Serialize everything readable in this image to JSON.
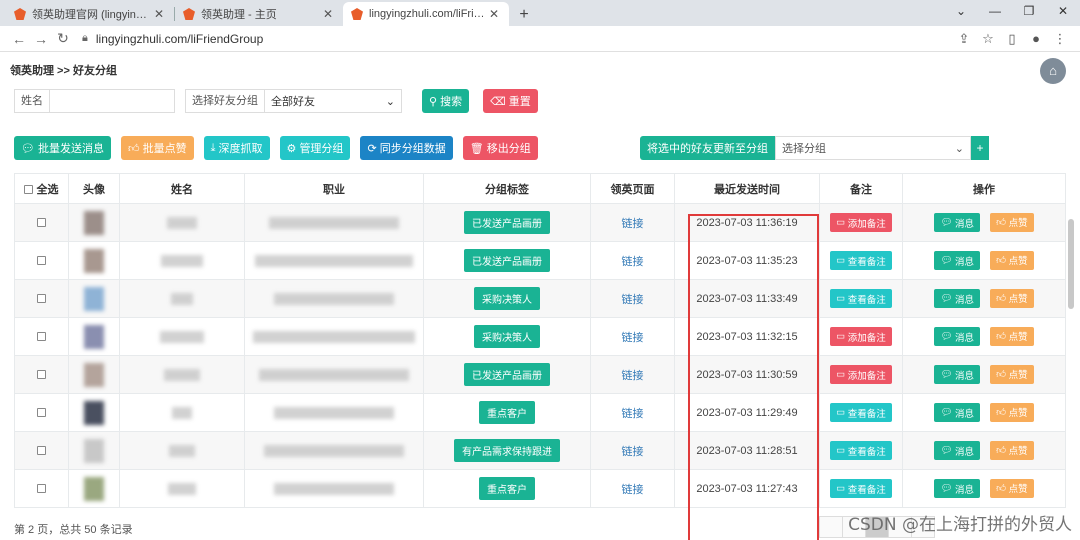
{
  "browser": {
    "tabs": [
      {
        "title": "领英助理官网 (lingyingzhuli.co"
      },
      {
        "title": "领英助理 - 主页"
      },
      {
        "title": "lingyingzhuli.com/liFriendGro"
      }
    ],
    "url": "lingyingzhuli.com/liFriendGroup"
  },
  "breadcrumb": "领英助理 >> 好友分组",
  "filter": {
    "name_label": "姓名",
    "group_label": "选择好友分组",
    "group_value": "全部好友",
    "search_label": "搜索",
    "reset_label": "重置"
  },
  "toolbar": {
    "bulk_message": "批量发送消息",
    "bulk_like": "批量点赞",
    "deep_fetch": "深度抓取",
    "manage_group": "管理分组",
    "sync_group": "同步分组数据",
    "remove_group": "移出分组",
    "update_selected": "将选中的好友更新至分组",
    "choose_group": "选择分组"
  },
  "table": {
    "headers": [
      "全选",
      "头像",
      "姓名",
      "职业",
      "分组标签",
      "领英页面",
      "最近发送时间",
      "备注",
      "操作"
    ],
    "rows": [
      {
        "tag": "已发送产品画册",
        "link": "链接",
        "time": "2023-07-03 11:36:19",
        "note": "添加备注",
        "note_color": "red"
      },
      {
        "tag": "已发送产品画册",
        "link": "链接",
        "time": "2023-07-03 11:35:23",
        "note": "查看备注",
        "note_color": "cyan"
      },
      {
        "tag": "采购决策人",
        "link": "链接",
        "time": "2023-07-03 11:33:49",
        "note": "查看备注",
        "note_color": "cyan"
      },
      {
        "tag": "采购决策人",
        "link": "链接",
        "time": "2023-07-03 11:32:15",
        "note": "添加备注",
        "note_color": "red"
      },
      {
        "tag": "已发送产品画册",
        "link": "链接",
        "time": "2023-07-03 11:30:59",
        "note": "添加备注",
        "note_color": "red"
      },
      {
        "tag": "重点客户",
        "link": "链接",
        "time": "2023-07-03 11:29:49",
        "note": "查看备注",
        "note_color": "cyan"
      },
      {
        "tag": "有产品需求保持跟进",
        "link": "链接",
        "time": "2023-07-03 11:28:51",
        "note": "查看备注",
        "note_color": "cyan"
      },
      {
        "tag": "重点客户",
        "link": "链接",
        "time": "2023-07-03 11:27:43",
        "note": "查看备注",
        "note_color": "cyan"
      }
    ],
    "action_message": "消息",
    "action_like": "点赞"
  },
  "footer": {
    "summary": "第 2 页，总共 50 条记录",
    "watermark": "CSDN @在上海打拼的外贸人"
  },
  "colors": {
    "teal": "#1ab394",
    "red": "#ed5565",
    "orange": "#f8ac59",
    "cyan": "#23c6c8",
    "blue": "#1c84c6",
    "highlight": "#e03a3a"
  }
}
